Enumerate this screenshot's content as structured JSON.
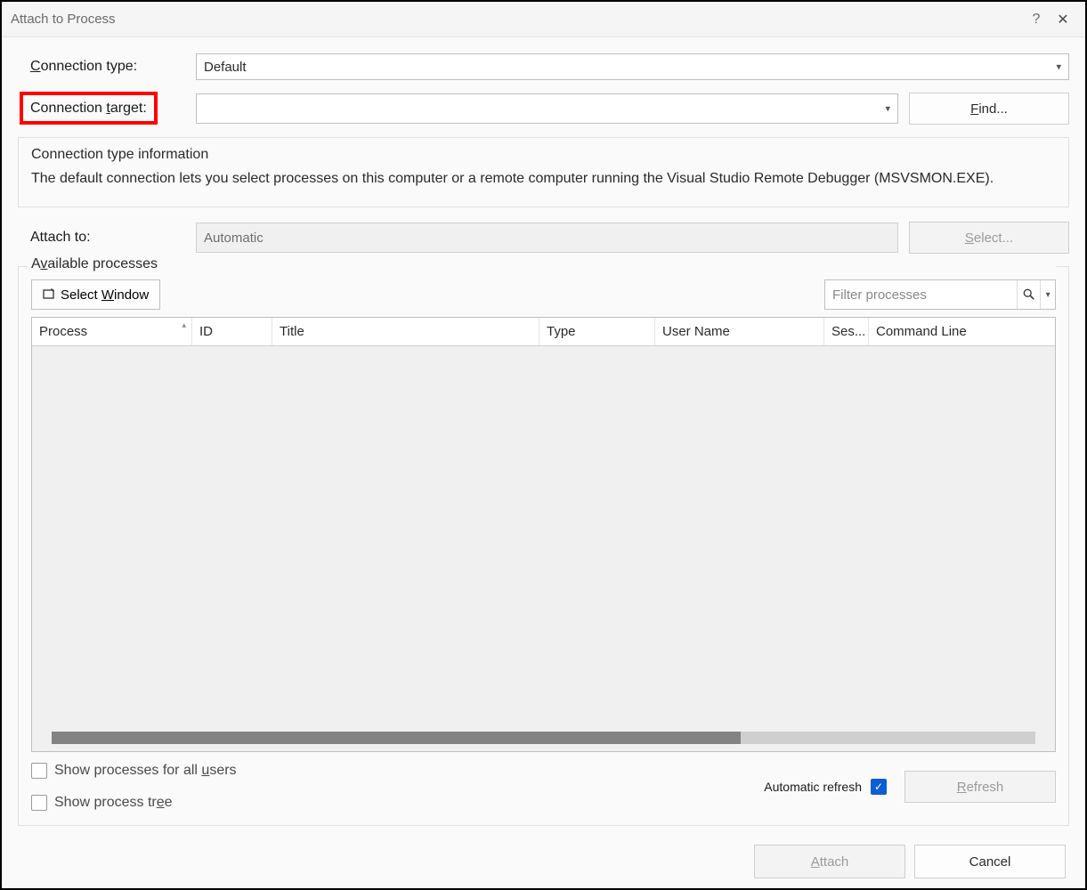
{
  "title": "Attach to Process",
  "labels": {
    "connection_type": "Connection type:",
    "connection_target": "Connection target:",
    "attach_to": "Attach to:",
    "available_processes": "Available processes",
    "connection_info_title": "Connection type information",
    "connection_info_text": "The default connection lets you select processes on this computer or a remote computer running the Visual Studio Remote Debugger (MSVSMON.EXE).",
    "automatic_refresh": "Automatic refresh",
    "show_all_users": "Show processes for all users",
    "show_tree": "Show process tree"
  },
  "fields": {
    "connection_type_value": "Default",
    "connection_target_value": "",
    "attach_to_value": "Automatic",
    "filter_placeholder": "Filter processes"
  },
  "buttons": {
    "find": "Find...",
    "select": "Select...",
    "select_window": "Select Window",
    "refresh": "Refresh",
    "attach": "Attach",
    "cancel": "Cancel"
  },
  "columns": {
    "process": "Process",
    "id": "ID",
    "title": "Title",
    "type": "Type",
    "user_name": "User Name",
    "session": "Ses...",
    "command_line": "Command Line"
  },
  "checkboxes": {
    "show_all_users": false,
    "show_tree": false,
    "automatic_refresh": true
  }
}
